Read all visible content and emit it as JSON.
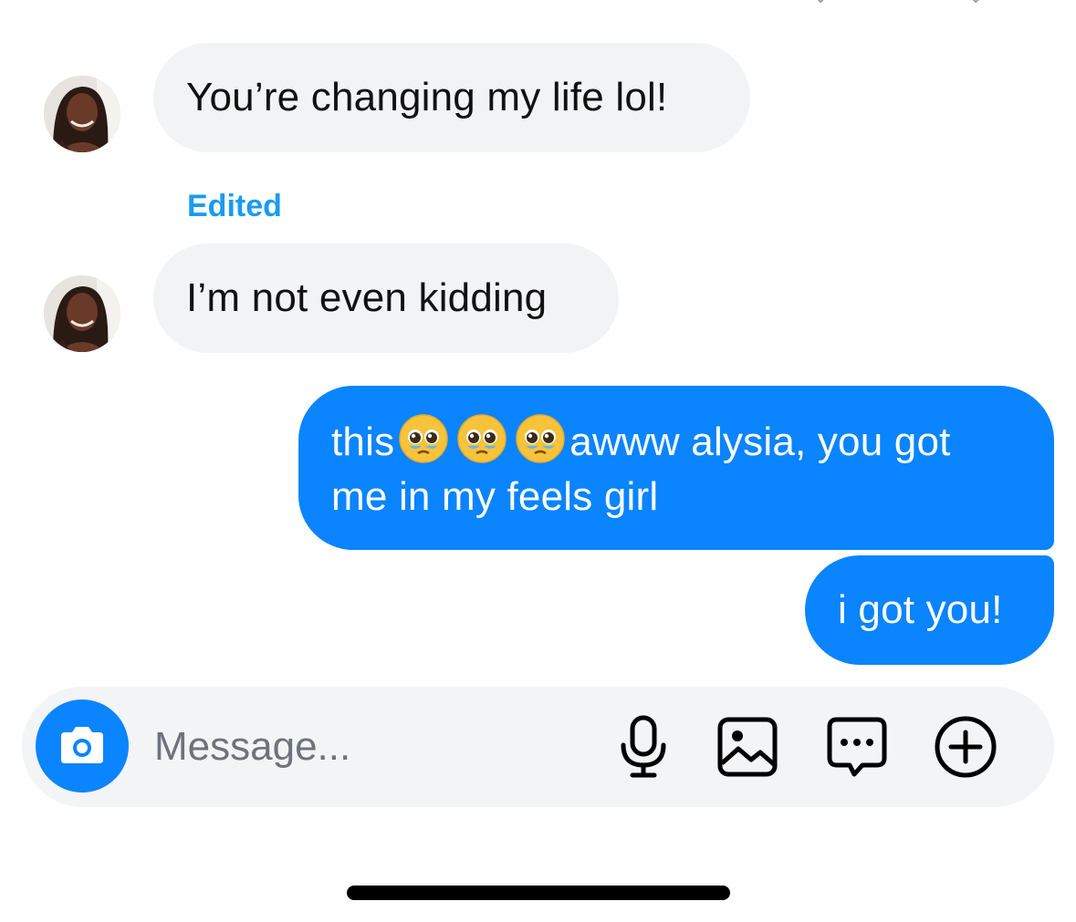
{
  "messages": {
    "incoming_1": "You’re changing my life lol!",
    "edited_label": "Edited",
    "incoming_2": "I’m not even kidding",
    "outgoing_1": {
      "prefix": "this",
      "line1_suffix": "awww alysia, you got",
      "line2": "me in my feels girl",
      "emoji": [
        "pleading-face-emoji",
        "pleading-face-emoji",
        "pleading-face-emoji"
      ]
    },
    "outgoing_2": "i got you!"
  },
  "composer": {
    "placeholder": "Message..."
  },
  "colors": {
    "outgoing_bubble": "#0a84ff",
    "incoming_bubble": "#f2f3f5",
    "edited_label": "#1a9bf0",
    "composer_background": "#f3f4f5"
  },
  "icons": {
    "camera": "camera-icon",
    "mic": "microphone-icon",
    "gallery": "image-icon",
    "sticker": "chat-bubble-icon",
    "more": "plus-circle-icon"
  }
}
